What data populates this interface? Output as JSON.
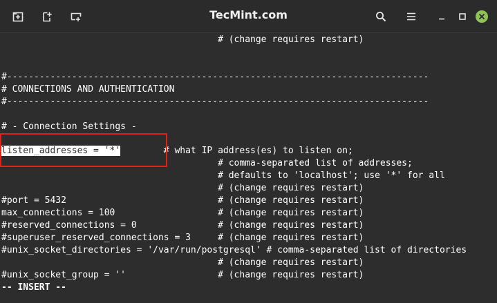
{
  "window": {
    "title": "TecMint.com"
  },
  "toolbar": {
    "left_buttons": [
      {
        "icon": "new-tab-icon"
      },
      {
        "icon": "new-window-icon"
      },
      {
        "icon": "split-terminal-icon"
      }
    ],
    "right_buttons": [
      {
        "icon": "search-icon"
      },
      {
        "icon": "hamburger-menu-icon"
      },
      {
        "icon": "minimize-icon"
      },
      {
        "icon": "maximize-icon"
      },
      {
        "icon": "close-icon"
      }
    ]
  },
  "terminal": {
    "lines": [
      "                                        # (change requires restart)",
      "",
      "",
      "#------------------------------------------------------------------------------",
      "# CONNECTIONS AND AUTHENTICATION",
      "#------------------------------------------------------------------------------",
      "",
      "# - Connection Settings -",
      "",
      "",
      "                                        # comma-separated list of addresses;",
      "                                        # defaults to 'localhost'; use '*' for all",
      "                                        # (change requires restart)",
      "#port = 5432                            # (change requires restart)",
      "max_connections = 100                   # (change requires restart)",
      "#reserved_connections = 0               # (change requires restart)",
      "#superuser_reserved_connections = 3     # (change requires restart)",
      "#unix_socket_directories = '/var/run/postgresql' # comma-separated list of directories",
      "                                        # (change requires restart)",
      "#unix_socket_group = ''                 # (change requires restart)",
      "-- INSERT --"
    ],
    "listen_line": {
      "selected_text": "listen_addresses = '*'",
      "comment": "        # what IP address(es) to listen on;"
    }
  },
  "colors": {
    "background": "#2d2d2d",
    "text": "#ffffff",
    "highlight_border": "#e0201b"
  }
}
